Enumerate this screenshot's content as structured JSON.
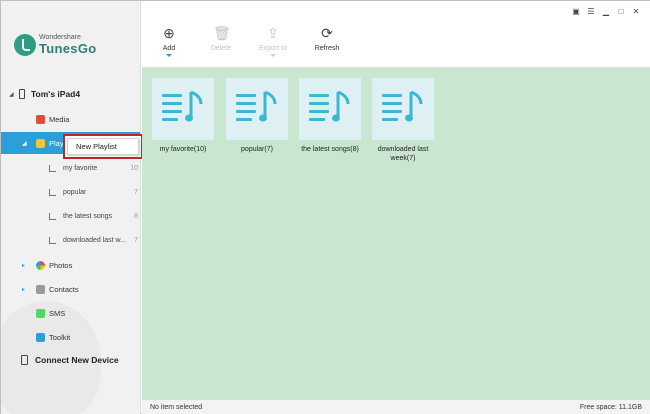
{
  "app": {
    "brand": "Wondershare",
    "product": "TunesGo"
  },
  "device": {
    "name": "Tom's iPad4"
  },
  "nav": {
    "media": "Media",
    "playlist": "Playlist",
    "photos": "Photos",
    "contacts": "Contacts",
    "sms": "SMS",
    "toolkit": "Toolkit",
    "connect": "Connect New Device"
  },
  "playlists": [
    {
      "label": "my favorite",
      "count": "10"
    },
    {
      "label": "popular",
      "count": "7"
    },
    {
      "label": "the latest songs",
      "count": "8"
    },
    {
      "label": "downloaded last w...",
      "count": "7"
    }
  ],
  "popup": {
    "label": "New Playlist"
  },
  "toolbar": {
    "add": "Add",
    "delete": "Delete",
    "export": "Export to",
    "refresh": "Refresh"
  },
  "tiles": [
    {
      "label": "my favorite(10)"
    },
    {
      "label": "popular(7)"
    },
    {
      "label": "the latest songs(8)"
    },
    {
      "label": "downloaded last week(7)"
    }
  ],
  "status": {
    "left": "No item selected",
    "right": "Free space: 11.1GB"
  },
  "colors": {
    "accent": "#2ba0d8",
    "content_bg": "#c9e6d0",
    "popup_border": "#c0262d",
    "brand": "#2f7f73"
  }
}
